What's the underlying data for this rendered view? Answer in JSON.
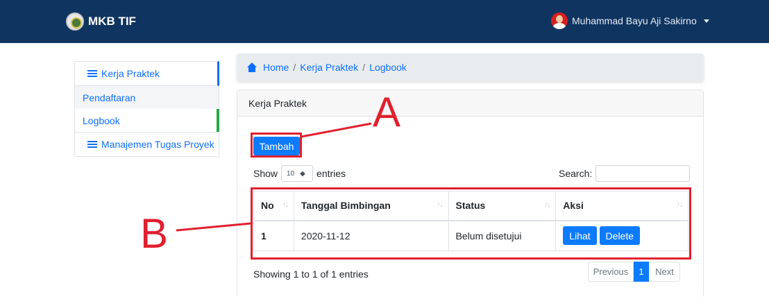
{
  "navbar": {
    "brand": "MKB TIF",
    "user_name": "Muhammad Bayu Aji Sakirno"
  },
  "sidebar": {
    "section": "Kerja Praktek",
    "items": [
      {
        "label": "Pendaftaran"
      },
      {
        "label": "Logbook"
      }
    ],
    "footer": "Manajemen Tugas Proyek"
  },
  "breadcrumb": {
    "home": "Home",
    "mid": "Kerja Praktek",
    "current": "Logbook"
  },
  "card": {
    "title": "Kerja Praktek",
    "add_button": "Tambah",
    "show_label": "Show",
    "entries_value": "10",
    "entries_label": "entries",
    "search_label": "Search:",
    "table": {
      "headers": [
        "No",
        "Tanggal Bimbingan",
        "Status",
        "Aksi"
      ],
      "rows": [
        {
          "no": "1",
          "tanggal": "2020-11-12",
          "status": "Belum disetujui",
          "view": "Lihat",
          "delete": "Delete"
        }
      ]
    },
    "info": "Showing 1 to 1 of 1 entries",
    "pager": {
      "previous": "Previous",
      "current": "1",
      "next": "Next"
    }
  },
  "annotations": {
    "a": "A",
    "b": "B"
  },
  "colors": {
    "navbar": "#0f3460",
    "primary": "#0d7bff",
    "annotation": "#e0202e",
    "active_marker": "#28a745"
  }
}
